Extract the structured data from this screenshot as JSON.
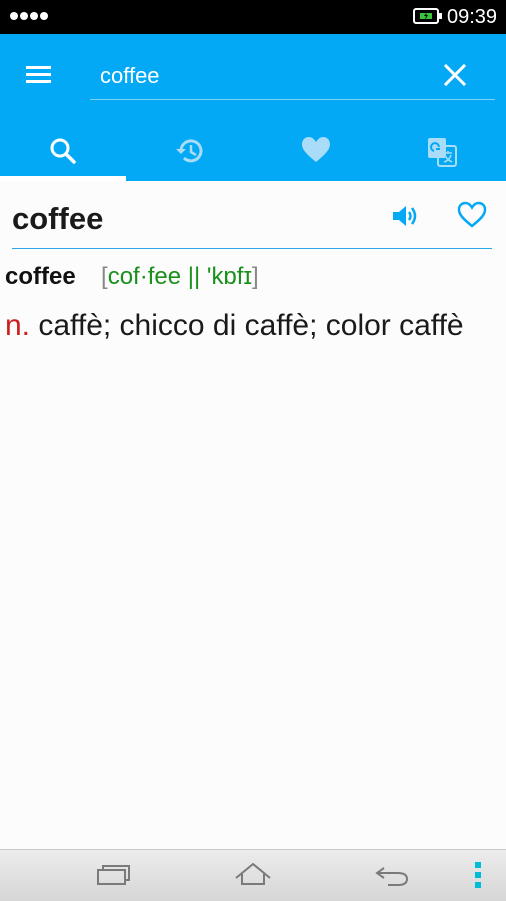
{
  "status_bar": {
    "time": "09:39",
    "icons": [
      "signal-icon",
      "battery-charging-icon"
    ]
  },
  "search": {
    "value": "coffee",
    "icons": [
      "menu-icon",
      "clear-icon"
    ]
  },
  "tabs": [
    {
      "name": "search",
      "icon": "search-icon",
      "active": true
    },
    {
      "name": "history",
      "icon": "history-icon",
      "active": false
    },
    {
      "name": "favorites",
      "icon": "heart-icon",
      "active": false
    },
    {
      "name": "translate",
      "icon": "translate-icon",
      "active": false
    }
  ],
  "entry": {
    "headword": "coffee",
    "word": "coffee",
    "bracket_open": "[",
    "pronunciation": "cof·fee || 'kɒfɪ",
    "bracket_close": "]",
    "pos": "n.",
    "definition": "caffè; chicco di caffè; color caffè",
    "icons": [
      "speaker-icon",
      "heart-outline-icon"
    ]
  },
  "nav_bar": {
    "icons": [
      "recent-apps-icon",
      "home-icon",
      "back-icon",
      "menu-dots-icon"
    ]
  },
  "colors": {
    "accent": "#03a9f4",
    "status_bar": "#000000",
    "pos": "#cc1e1e",
    "pronunciation": "#1b8f1b",
    "divider": "#29a7e8"
  }
}
